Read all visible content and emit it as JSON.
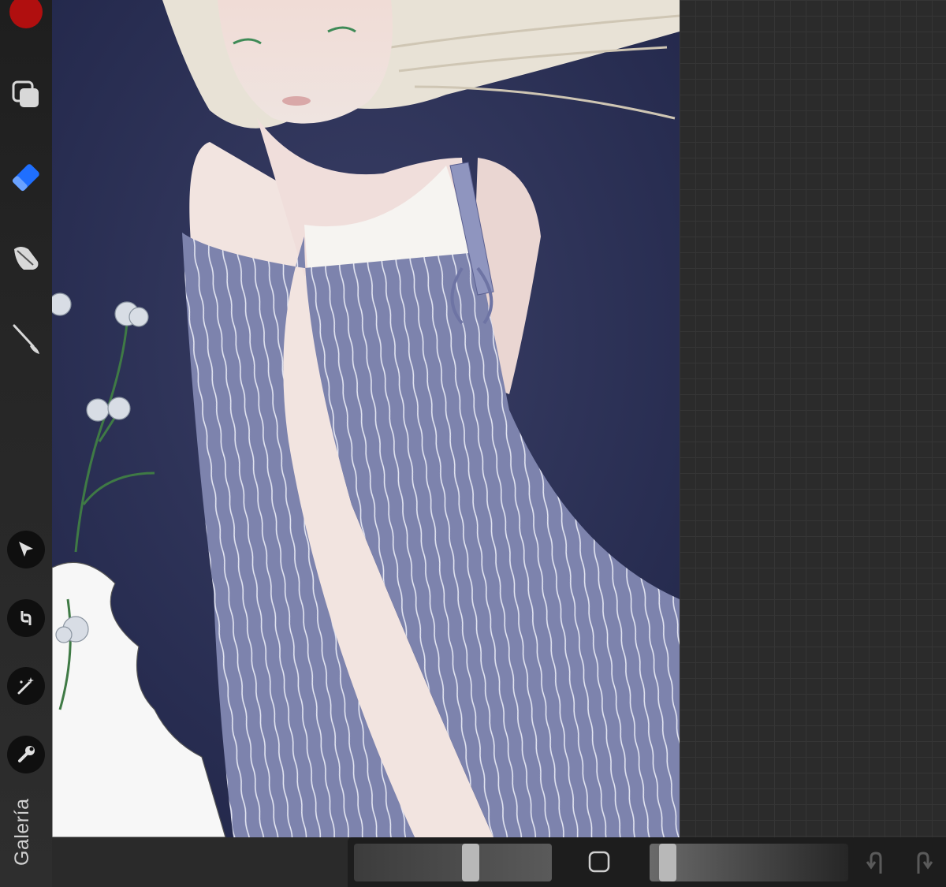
{
  "sidebar": {
    "color": "#b00f0f",
    "tools": [
      {
        "name": "layers",
        "icon": "layers-icon"
      },
      {
        "name": "eraser",
        "icon": "eraser-icon",
        "active_color": "#1f6fff"
      },
      {
        "name": "smudge",
        "icon": "smudge-icon"
      },
      {
        "name": "brush",
        "icon": "brush-icon"
      }
    ],
    "actions": [
      {
        "name": "selection",
        "icon": "selection-arrow-icon"
      },
      {
        "name": "transform",
        "icon": "transform-icon"
      },
      {
        "name": "adjustments",
        "icon": "magic-wand-icon"
      },
      {
        "name": "actions",
        "icon": "wrench-icon"
      }
    ],
    "gallery_label": "Galería"
  },
  "bottom_bar": {
    "brush_size": 0.6,
    "opacity": 0.05,
    "modify_icon": "square-icon",
    "undo_icon": "undo-icon",
    "redo_icon": "redo-icon"
  },
  "canvas": {
    "background_color": "#24294d",
    "artwork": "illustration-girl-striped-dress"
  }
}
